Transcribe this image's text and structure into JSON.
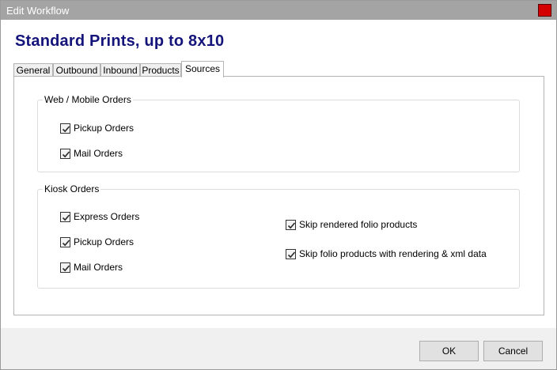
{
  "window": {
    "title": "Edit Workflow",
    "close_icon": "close-icon",
    "close_color": "#d40000"
  },
  "heading": "Standard Prints, up to 8x10",
  "tabs": [
    {
      "label": "General",
      "active": false
    },
    {
      "label": "Outbound",
      "active": false
    },
    {
      "label": "Inbound",
      "active": false
    },
    {
      "label": "Products",
      "active": false
    },
    {
      "label": "Sources",
      "active": true
    }
  ],
  "sources": {
    "web_mobile": {
      "title": "Web / Mobile Orders",
      "options": [
        {
          "label": "Pickup Orders",
          "checked": true
        },
        {
          "label": "Mail Orders",
          "checked": true
        }
      ]
    },
    "kiosk": {
      "title": "Kiosk Orders",
      "options": [
        {
          "label": "Express Orders",
          "checked": true
        },
        {
          "label": "Pickup Orders",
          "checked": true
        },
        {
          "label": "Mail Orders",
          "checked": true
        }
      ],
      "folio_options": [
        {
          "label": "Skip rendered folio products",
          "checked": true
        },
        {
          "label": "Skip folio products with rendering & xml data",
          "checked": true
        }
      ]
    }
  },
  "buttons": {
    "ok": "OK",
    "cancel": "Cancel"
  },
  "colors": {
    "heading": "#14147a",
    "titlebar": "#a4a4a4",
    "check_icon": "check-icon"
  }
}
